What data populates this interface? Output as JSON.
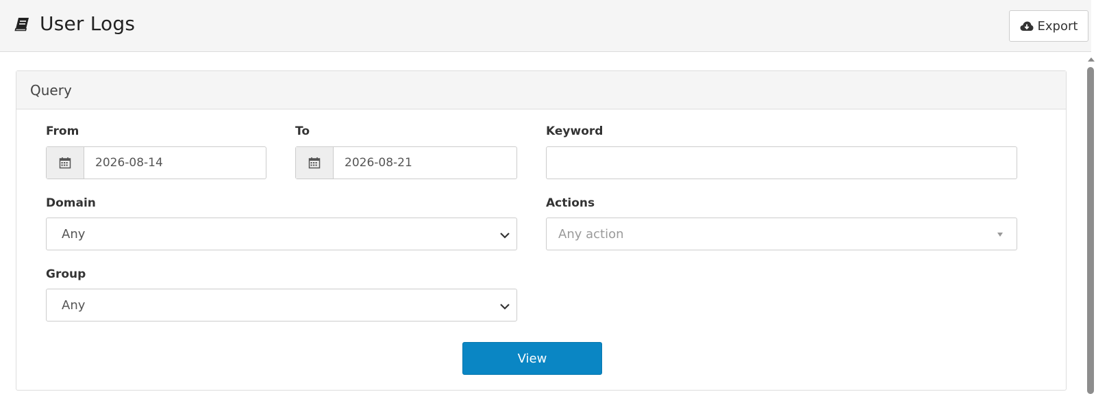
{
  "header": {
    "title": "User Logs",
    "title_icon": "book-icon",
    "export_label": "Export",
    "export_icon": "cloud-download-icon"
  },
  "query_panel": {
    "title": "Query",
    "from": {
      "label": "From",
      "value": "2026-08-14",
      "icon": "calendar-icon"
    },
    "to": {
      "label": "To",
      "value": "2026-08-21",
      "icon": "calendar-icon"
    },
    "keyword": {
      "label": "Keyword",
      "value": ""
    },
    "domain": {
      "label": "Domain",
      "selected": "Any"
    },
    "actions": {
      "label": "Actions",
      "placeholder": "Any action"
    },
    "group": {
      "label": "Group",
      "selected": "Any"
    },
    "view_label": "View"
  },
  "colors": {
    "primary_button": "#0a86c4",
    "header_bg": "#f5f5f5"
  }
}
